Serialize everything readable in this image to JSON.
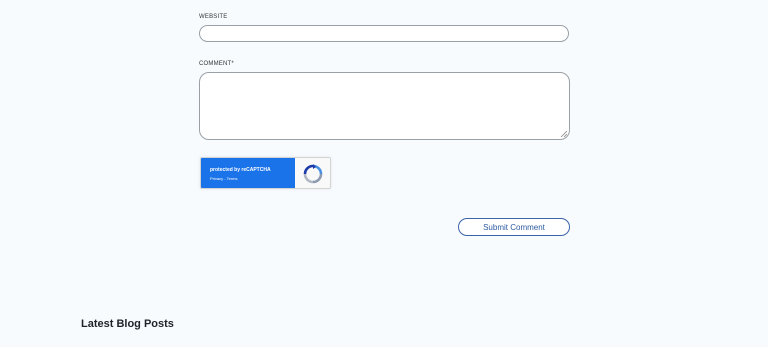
{
  "form": {
    "website_label": "WEBSITE",
    "website_value": "",
    "comment_label": "COMMENT*",
    "comment_value": "",
    "submit_label": "Submit Comment"
  },
  "recaptcha": {
    "protected_text": "protected by reCAPTCHA",
    "privacy_label": "Privacy",
    "separator": " - ",
    "terms_label": "Terms",
    "logo_icon": "recaptcha-logo-icon",
    "accent_color": "#1a73e8"
  },
  "section": {
    "heading": "Latest Blog Posts"
  },
  "colors": {
    "page_background": "#f7fbfe",
    "button_text": "#2c5aa0",
    "button_border": "#3c64a8"
  }
}
